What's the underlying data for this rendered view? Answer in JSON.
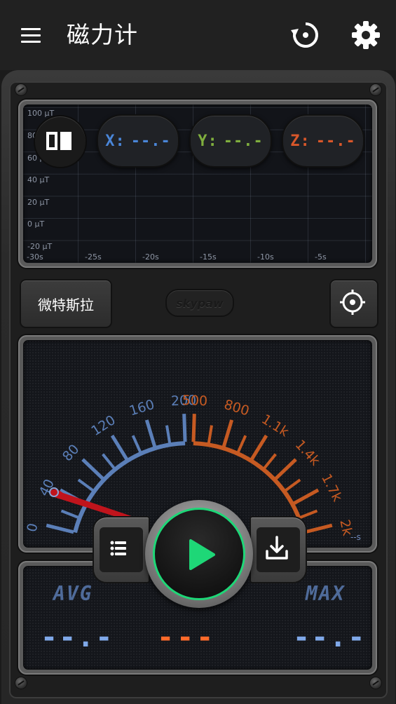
{
  "appbar": {
    "title": "磁力计"
  },
  "chart_data": {
    "type": "line",
    "title": "",
    "y_ticks": [
      "100 μT",
      "80 μT",
      "60 μT",
      "40 μT",
      "20 μT",
      "0 μT",
      "-20 μT"
    ],
    "x_ticks": [
      "-30s",
      "-25s",
      "-20s",
      "-15s",
      "-10s",
      "-5s"
    ],
    "ylim": [
      -20,
      100
    ],
    "xlim": [
      -30,
      0
    ],
    "grid": true,
    "series": []
  },
  "readouts": {
    "x": {
      "label": "X:",
      "value": "--.-"
    },
    "y": {
      "label": "Y:",
      "value": "--.-"
    },
    "z": {
      "label": "Z:",
      "value": "--.-"
    }
  },
  "unit_button": {
    "label": "微特斯拉"
  },
  "brand": {
    "label": "skypaw"
  },
  "gauge": {
    "left_labels": [
      "0",
      "40",
      "80",
      "120",
      "160",
      "200"
    ],
    "right_labels": [
      "500",
      "800",
      "1.1k",
      "1.4k",
      "1.7k",
      "2k"
    ],
    "time_label": "--s"
  },
  "stats": {
    "avg_label": "AVG",
    "max_label": "MAX",
    "avg_value": "--.-",
    "current_value": "---",
    "max_value": "--.-"
  },
  "colors": {
    "x": "#4a86d8",
    "y": "#7fae3e",
    "z": "#d9572a",
    "gauge_blue": "#5b7fb8",
    "gauge_orange": "#c65a22",
    "accent_green": "#1ed777",
    "needle": "#c0141c"
  }
}
